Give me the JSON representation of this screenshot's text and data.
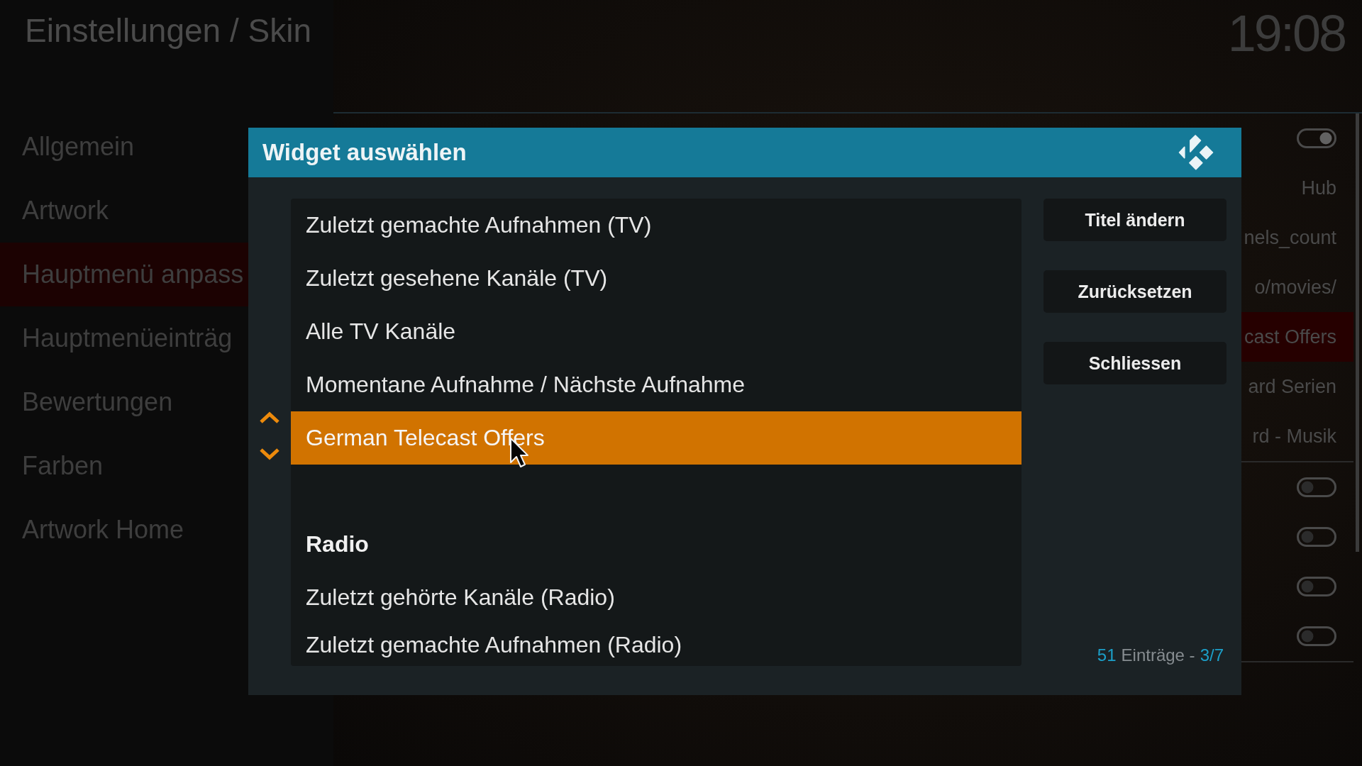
{
  "header": {
    "title": "Einstellungen / Skin",
    "clock": "19:08"
  },
  "sidebar": {
    "items": [
      {
        "label": "Allgemein",
        "selected": false
      },
      {
        "label": "Artwork",
        "selected": false
      },
      {
        "label": "Hauptmenü anpass",
        "selected": true
      },
      {
        "label": "Hauptmenüeinträg",
        "selected": false
      },
      {
        "label": "Bewertungen",
        "selected": false
      },
      {
        "label": "Farben",
        "selected": false
      },
      {
        "label": "Artwork Home",
        "selected": false
      }
    ]
  },
  "settings_list": {
    "groups": [
      {
        "rows": [
          {
            "kind": "toggle",
            "on": true,
            "selected": false
          },
          {
            "kind": "value",
            "value": "Hub",
            "selected": false
          },
          {
            "kind": "value",
            "value": "nels_count",
            "selected": false
          },
          {
            "kind": "value",
            "value": "o/movies/",
            "selected": false
          },
          {
            "kind": "value",
            "value": "cast Offers",
            "selected": true
          },
          {
            "kind": "value",
            "value": "ard Serien",
            "selected": false
          },
          {
            "kind": "value",
            "value": "rd - Musik",
            "selected": false
          }
        ]
      },
      {
        "rows": [
          {
            "kind": "toggle",
            "on": false,
            "selected": false
          },
          {
            "kind": "toggle",
            "on": false,
            "selected": false
          },
          {
            "kind": "toggle",
            "on": false,
            "selected": false
          },
          {
            "kind": "toggle",
            "on": false,
            "selected": false
          }
        ]
      }
    ]
  },
  "dialog": {
    "title": "Widget auswählen",
    "list": {
      "items": [
        {
          "kind": "item",
          "label": "Zuletzt gemachte Aufnahmen (TV)",
          "selected": false
        },
        {
          "kind": "item",
          "label": "Zuletzt gesehene Kanäle (TV)",
          "selected": false
        },
        {
          "kind": "item",
          "label": "Alle TV Kanäle",
          "selected": false
        },
        {
          "kind": "item",
          "label": "Momentane Aufnahme / Nächste Aufnahme",
          "selected": false
        },
        {
          "kind": "item",
          "label": "German Telecast Offers",
          "selected": true
        },
        {
          "kind": "heading",
          "label": "Radio",
          "selected": false
        },
        {
          "kind": "item",
          "label": "Zuletzt gehörte Kanäle (Radio)",
          "selected": false
        },
        {
          "kind": "item",
          "label": "Zuletzt gemachte Aufnahmen (Radio)",
          "selected": false
        }
      ]
    },
    "buttons": [
      {
        "label": "Titel ändern"
      },
      {
        "label": "Zurücksetzen"
      },
      {
        "label": "Schliessen"
      }
    ],
    "footer": {
      "count": "51",
      "label": "Einträge -",
      "page": "3/7"
    }
  }
}
